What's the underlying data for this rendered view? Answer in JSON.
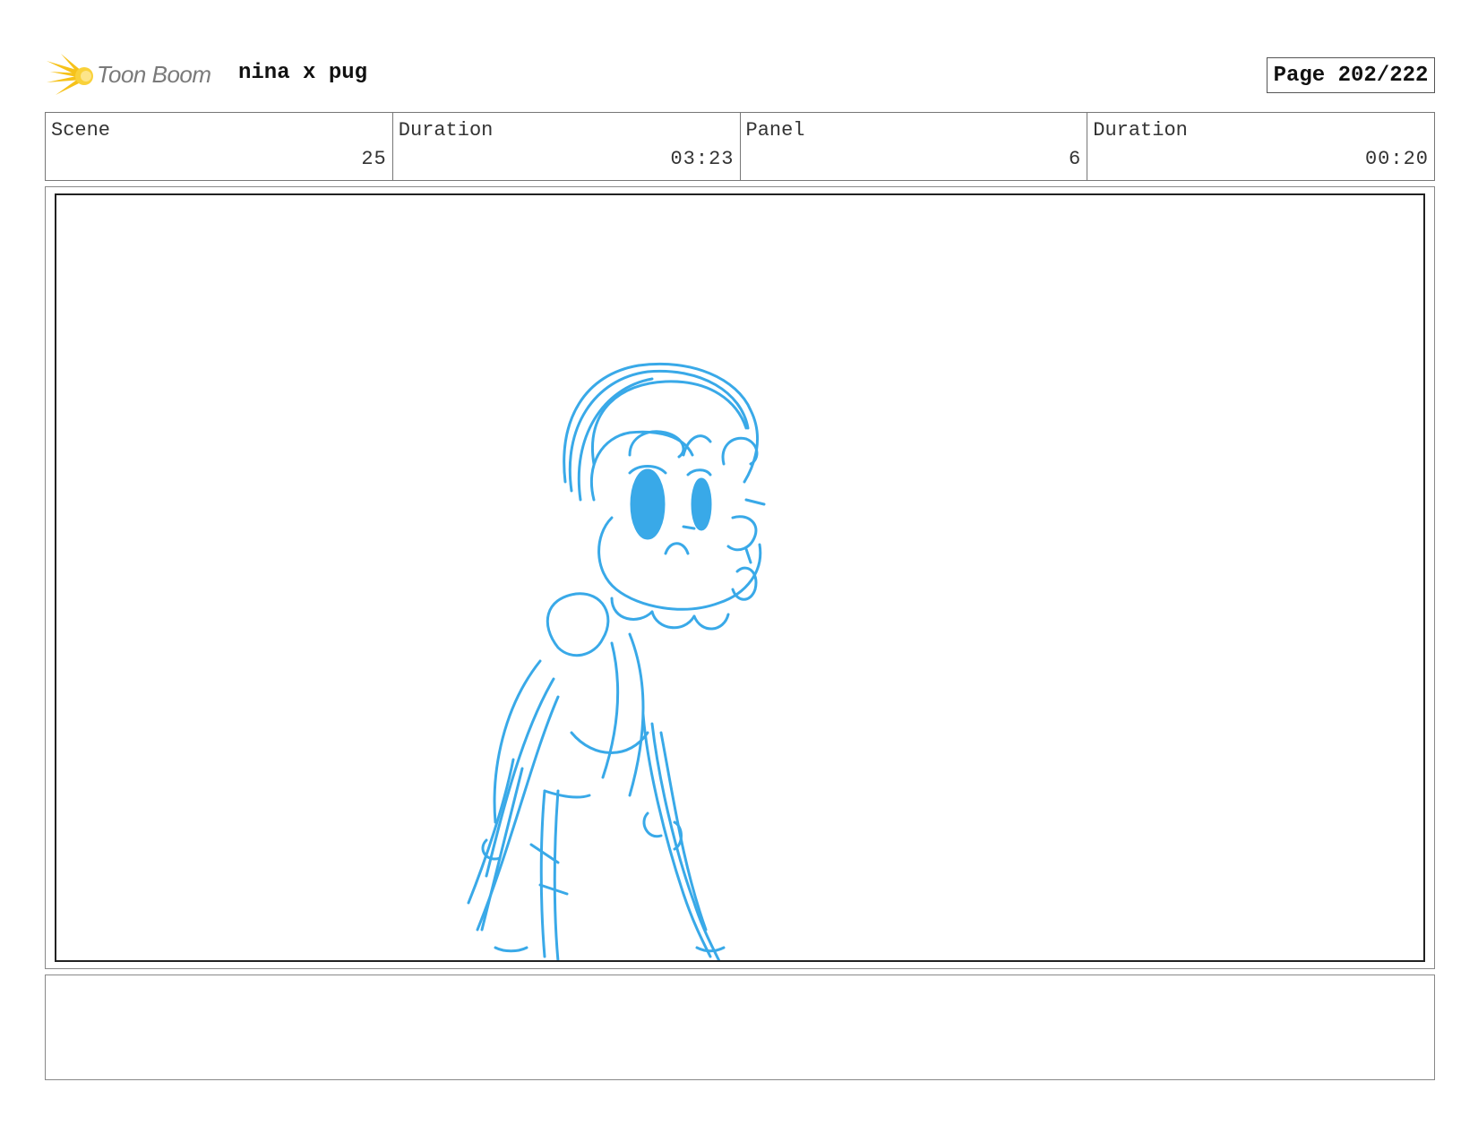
{
  "header": {
    "logo_text": "Toon Boom",
    "project_title": "nina x pug",
    "page_label": "Page 202/222"
  },
  "info": {
    "scene": {
      "label": "Scene",
      "value": "25"
    },
    "scene_duration": {
      "label": "Duration",
      "value": "03:23"
    },
    "panel": {
      "label": "Panel",
      "value": "6"
    },
    "panel_duration": {
      "label": "Duration",
      "value": "00:20"
    }
  },
  "colors": {
    "sketch": "#39a9e8",
    "logo_yellow": "#f6c21a",
    "logo_text": "#7a7a7a"
  },
  "notes": {
    "text": ""
  }
}
